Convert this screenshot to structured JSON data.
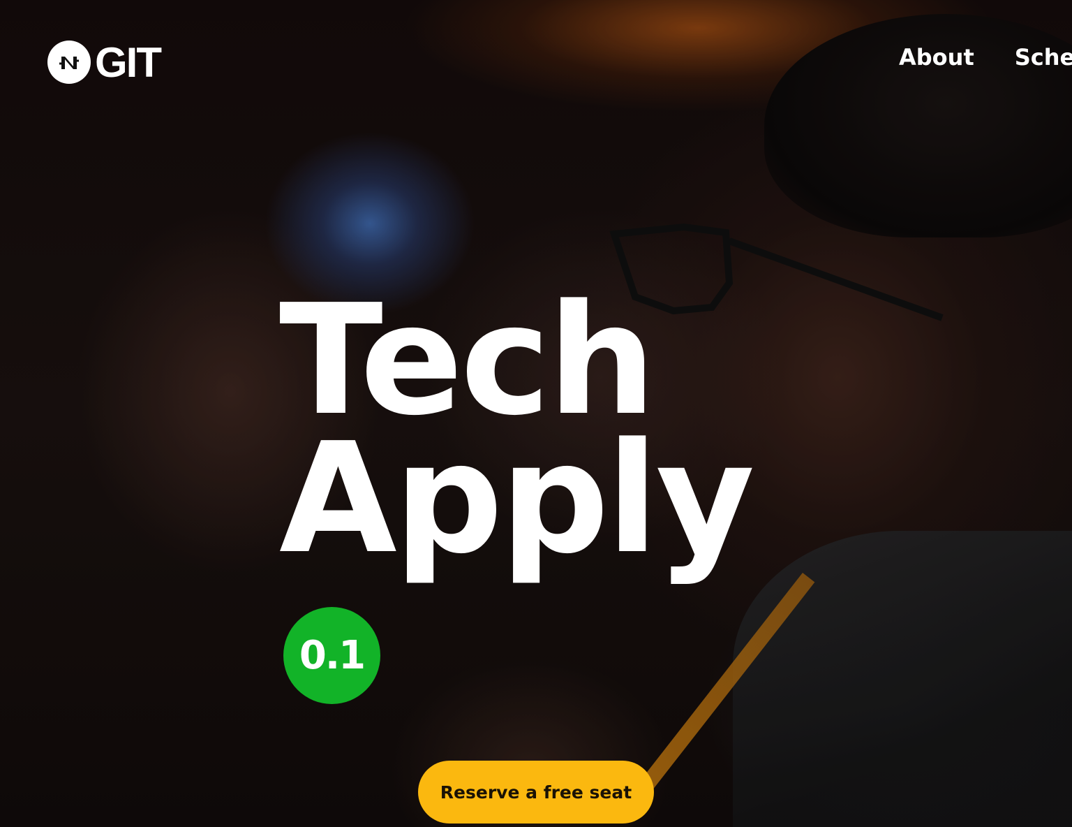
{
  "header": {
    "logo_text": "GIT",
    "nav": [
      {
        "label": "About"
      },
      {
        "label": "Schec"
      }
    ]
  },
  "hero": {
    "title_line1": "Tech",
    "title_line2": "Apply",
    "version_badge": "0.1",
    "cta_label": "Reserve a free seat"
  },
  "colors": {
    "badge": "#12b328",
    "cta": "#fbb80f",
    "text": "#ffffff"
  },
  "icons": {
    "logo_mark": "circle-logo-icon"
  }
}
